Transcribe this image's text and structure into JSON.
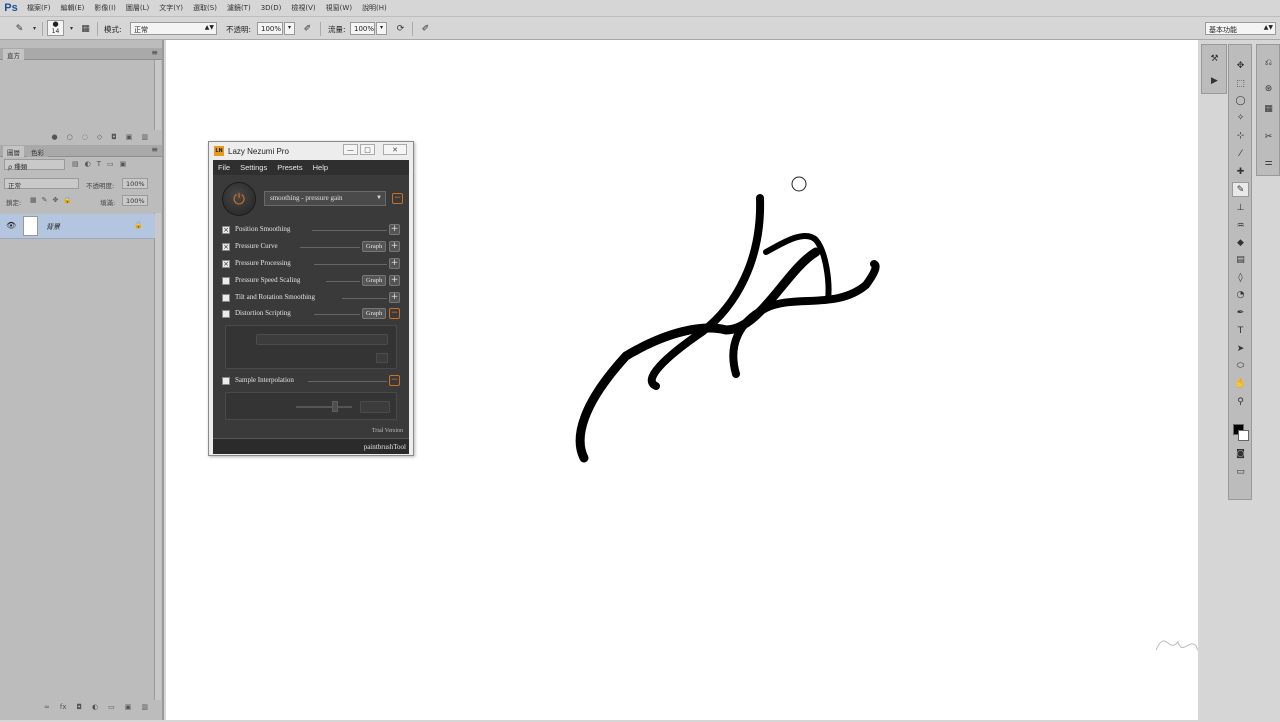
{
  "app": {
    "logo": "Ps"
  },
  "menu": [
    "檔案(F)",
    "編輯(E)",
    "影像(I)",
    "圖層(L)",
    "文字(Y)",
    "選取(S)",
    "濾鏡(T)",
    "3D(D)",
    "檢視(V)",
    "視窗(W)",
    "說明(H)"
  ],
  "options": {
    "brush_size": "14",
    "mode_label": "模式:",
    "mode_value": "正常",
    "opacity_label": "不透明:",
    "opacity_value": "100%",
    "flow_label": "流量:",
    "flow_value": "100%",
    "workspace": "基本功能"
  },
  "left": {
    "histogram_tab": "直方",
    "layers_tabs": [
      "圖層",
      "色彩"
    ],
    "filter_kind": "ρ 種類",
    "blend_mode": "正常",
    "opacity_label": "不透明度:",
    "opacity_value": "100%",
    "lock_label": "鎖定:",
    "fill_label": "填滿:",
    "fill_value": "100%",
    "layer_name": "背景"
  },
  "lazy": {
    "logo": "LN",
    "title": "Lazy Nezumi Pro",
    "menu": [
      "File",
      "Settings",
      "Presets",
      "Help"
    ],
    "preset": "smoothing - pressure gain",
    "features": [
      {
        "label": "Position Smoothing",
        "checked": true,
        "graph": false
      },
      {
        "label": "Pressure Curve",
        "checked": true,
        "graph": true
      },
      {
        "label": "Pressure Processing",
        "checked": true,
        "graph": false
      },
      {
        "label": "Pressure Speed Scaling",
        "checked": false,
        "graph": true
      },
      {
        "label": "Tilt and Rotation Smoothing",
        "checked": false,
        "graph": false
      },
      {
        "label": "Distortion Scripting",
        "checked": false,
        "graph": true
      }
    ],
    "graph_label": "Graph",
    "sample_label": "Sample Interpolation",
    "trial": "Trial Version",
    "status": "paintbrushTool"
  }
}
